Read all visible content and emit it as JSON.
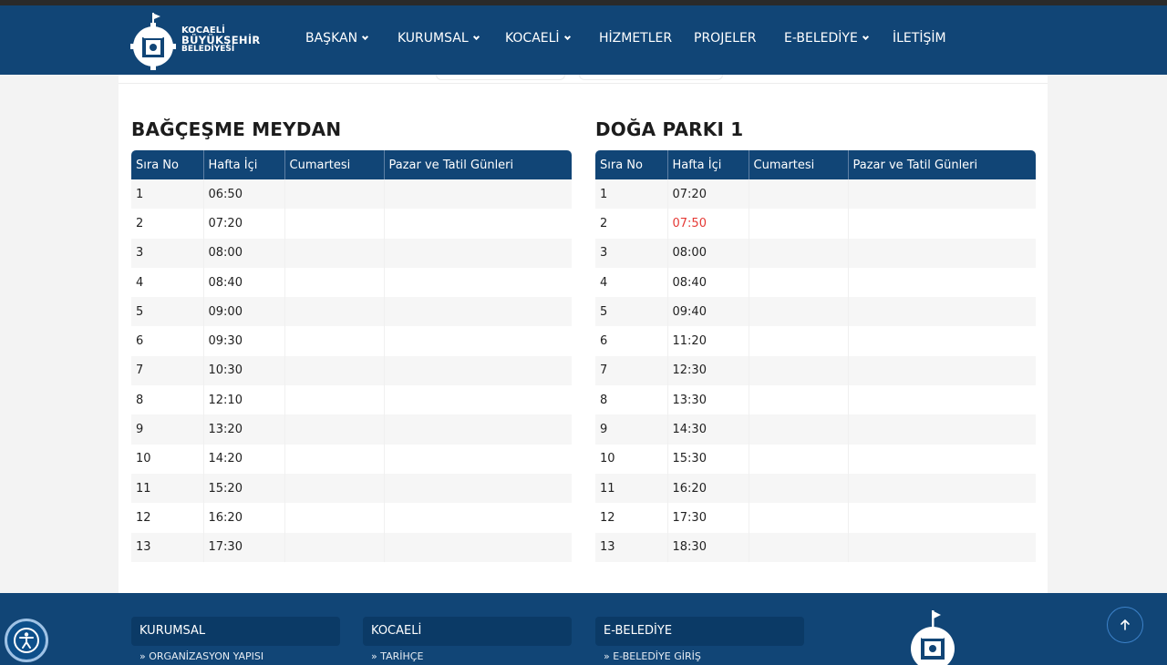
{
  "header": {
    "logo": {
      "line1": "KOCAELİ",
      "line2": "BÜYÜKŞEHİR",
      "line3": "BELEDİYESİ"
    },
    "nav": [
      {
        "label": "BAŞKAN",
        "has_dropdown": true
      },
      {
        "label": "KURUMSAL",
        "has_dropdown": true
      },
      {
        "label": "KOCAELİ",
        "has_dropdown": true
      },
      {
        "label": "HİZMETLER",
        "has_dropdown": false
      },
      {
        "label": "PROJELER",
        "has_dropdown": false
      },
      {
        "label": "E-BELEDİYE",
        "has_dropdown": true
      },
      {
        "label": "İLETİŞİM",
        "has_dropdown": false
      }
    ]
  },
  "schedules": [
    {
      "title": "BAĞÇEŞME MEYDAN",
      "columns": [
        "Sıra No",
        "Hafta İçi",
        "Cumartesi",
        "Pazar ve Tatil Günleri"
      ],
      "rows": [
        [
          "1",
          "06:50",
          "",
          ""
        ],
        [
          "2",
          "07:20",
          "",
          ""
        ],
        [
          "3",
          "08:00",
          "",
          ""
        ],
        [
          "4",
          "08:40",
          "",
          ""
        ],
        [
          "5",
          "09:00",
          "",
          ""
        ],
        [
          "6",
          "09:30",
          "",
          ""
        ],
        [
          "7",
          "10:30",
          "",
          ""
        ],
        [
          "8",
          "12:10",
          "",
          ""
        ],
        [
          "9",
          "13:20",
          "",
          ""
        ],
        [
          "10",
          "14:20",
          "",
          ""
        ],
        [
          "11",
          "15:20",
          "",
          ""
        ],
        [
          "12",
          "16:20",
          "",
          ""
        ],
        [
          "13",
          "17:30",
          "",
          ""
        ]
      ]
    },
    {
      "title": "DOĞA PARKI 1",
      "columns": [
        "Sıra No",
        "Hafta İçi",
        "Cumartesi",
        "Pazar ve Tatil Günleri"
      ],
      "rows": [
        [
          "1",
          "07:20",
          "",
          ""
        ],
        [
          "2",
          "07:50",
          "",
          ""
        ],
        [
          "3",
          "08:00",
          "",
          ""
        ],
        [
          "4",
          "08:40",
          "",
          ""
        ],
        [
          "5",
          "09:40",
          "",
          ""
        ],
        [
          "6",
          "11:20",
          "",
          ""
        ],
        [
          "7",
          "12:30",
          "",
          ""
        ],
        [
          "8",
          "13:30",
          "",
          ""
        ],
        [
          "9",
          "14:30",
          "",
          ""
        ],
        [
          "10",
          "15:30",
          "",
          ""
        ],
        [
          "11",
          "16:20",
          "",
          ""
        ],
        [
          "12",
          "17:30",
          "",
          ""
        ],
        [
          "13",
          "18:30",
          "",
          ""
        ]
      ],
      "highlight": {
        "row": 1,
        "col": 1,
        "color": "#e53935"
      }
    }
  ],
  "footer": {
    "sections": [
      {
        "title": "KURUMSAL",
        "first_link": "» ORGANİZASYON YAPISI"
      },
      {
        "title": "KOCAELİ",
        "first_link": "» TARİHÇE"
      },
      {
        "title": "E-BELEDİYE",
        "first_link": "» E-BELEDİYE GİRİŞ"
      }
    ]
  },
  "icons": {
    "accessibility": "accessibility-icon",
    "scroll_top": "arrow-up-icon",
    "logo": "kocaeli-logo-icon"
  },
  "colors": {
    "primary": "#114576",
    "footer_box": "#0b3a66",
    "highlight": "#e53935"
  }
}
